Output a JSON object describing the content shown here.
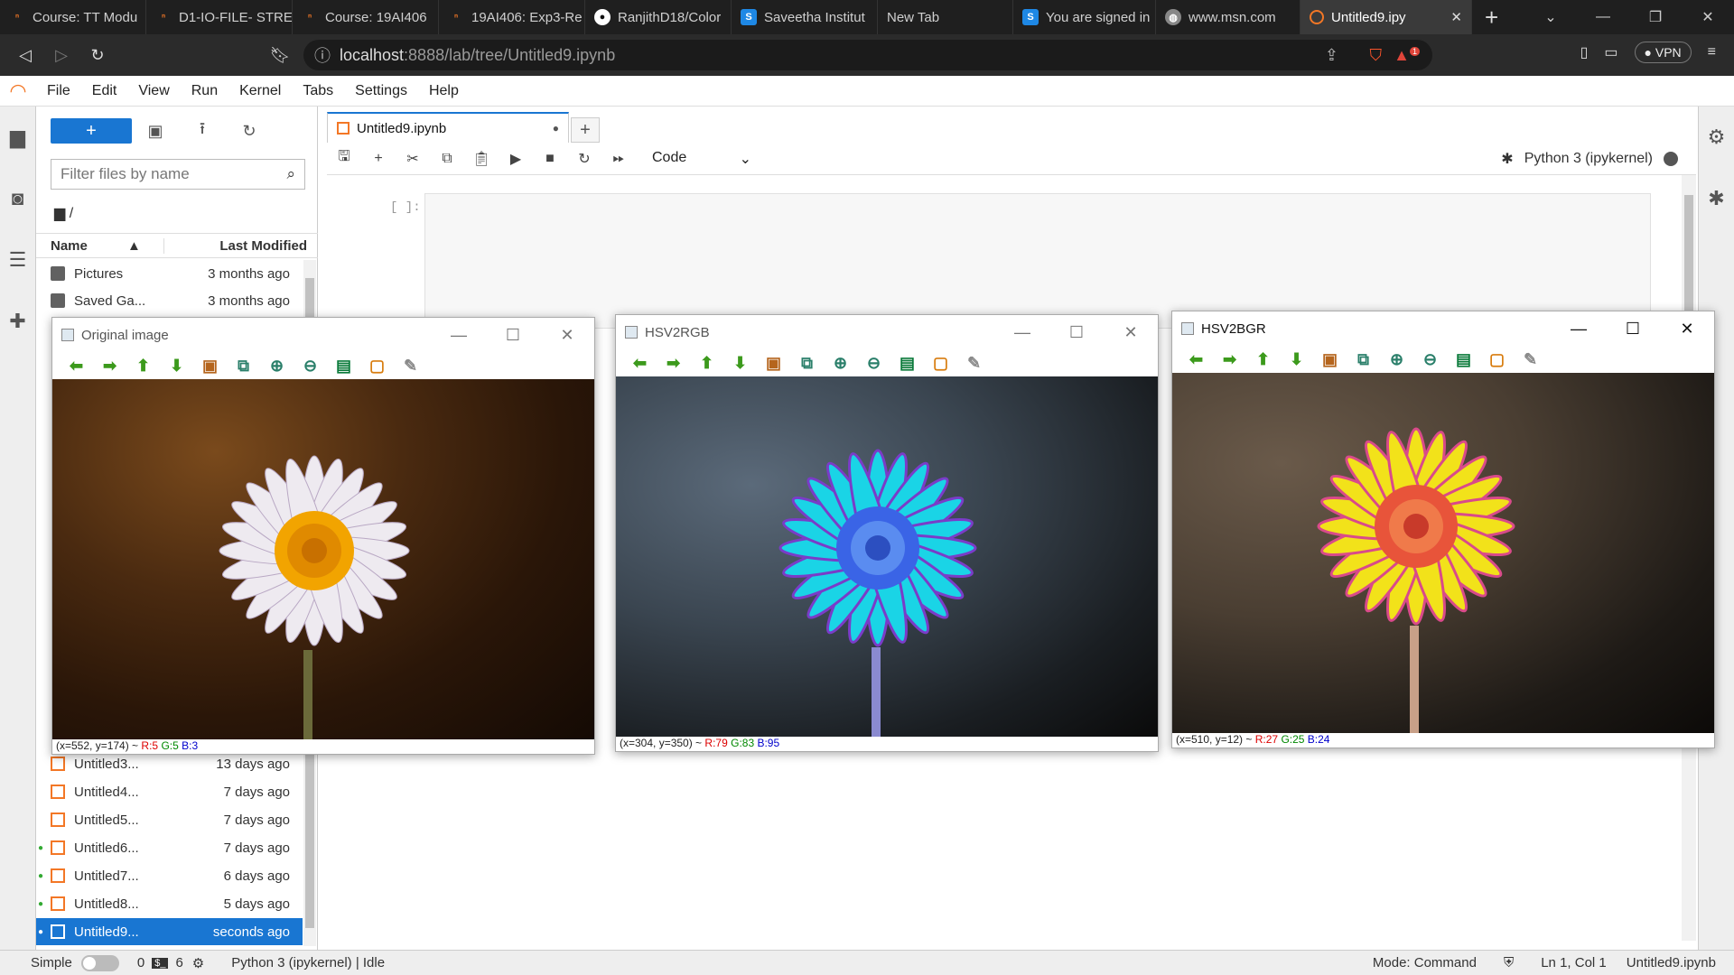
{
  "browser": {
    "tabs": [
      {
        "label": "Course: TT Modu",
        "icon": "moodle-icon",
        "color": "#f37726"
      },
      {
        "label": "D1-IO-FILE- STRE",
        "icon": "moodle-icon",
        "color": "#f37726"
      },
      {
        "label": "Course: 19AI406",
        "icon": "moodle-icon",
        "color": "#f37726"
      },
      {
        "label": "19AI406: Exp3-Re",
        "icon": "moodle-icon",
        "color": "#f37726"
      },
      {
        "label": "RanjithD18/Color",
        "icon": "github-icon",
        "color": "#ffffff"
      },
      {
        "label": "Saveetha Institut",
        "icon": "saveetha-icon",
        "color": "#1e88e5"
      },
      {
        "label": "New Tab",
        "icon": "",
        "color": "#1f1f1f"
      },
      {
        "label": "You are signed in",
        "icon": "saveetha-icon",
        "color": "#1e88e5"
      },
      {
        "label": "www.msn.com",
        "icon": "globe-icon",
        "color": "#888888"
      }
    ],
    "active_tab": {
      "label": "Untitled9.ipy",
      "icon": "jupyter-icon"
    },
    "url_host": "localhost",
    "url_rest": ":8888/lab/tree/Untitled9.ipynb",
    "vpn_label": "VPN",
    "brave_badge": "1"
  },
  "menu": [
    "File",
    "Edit",
    "View",
    "Run",
    "Kernel",
    "Tabs",
    "Settings",
    "Help"
  ],
  "filebrowser": {
    "new_label": "+",
    "filter_placeholder": "Filter files by name",
    "path": "/",
    "col_name": "Name",
    "col_modified": "Last Modified",
    "files_top": [
      {
        "name": "Pictures",
        "modified": "3 months ago",
        "type": "folder",
        "running": false
      },
      {
        "name": "Saved Ga...",
        "modified": "3 months ago",
        "type": "folder",
        "running": false
      }
    ],
    "files_bottom": [
      {
        "name": "Untitled3...",
        "modified": "13 days ago",
        "running": false
      },
      {
        "name": "Untitled4...",
        "modified": "7 days ago",
        "running": false
      },
      {
        "name": "Untitled5...",
        "modified": "7 days ago",
        "running": false
      },
      {
        "name": "Untitled6...",
        "modified": "7 days ago",
        "running": true
      },
      {
        "name": "Untitled7...",
        "modified": "6 days ago",
        "running": true
      },
      {
        "name": "Untitled8...",
        "modified": "5 days ago",
        "running": true
      },
      {
        "name": "Untitled9...",
        "modified": "seconds ago",
        "running": true,
        "selected": true
      }
    ]
  },
  "notebook": {
    "tab_label": "Untitled9.ipynb",
    "cell_type": "Code",
    "kernel": "Python 3 (ipykernel)",
    "prompt": "[ ]:"
  },
  "statusbar": {
    "mode_simple": "Simple",
    "terminals": "0",
    "kernels": "6",
    "kernel_status": "Python 3 (ipykernel) | Idle",
    "mode": "Mode: Command",
    "cursor": "Ln 1, Col 1",
    "filename": "Untitled9.ipynb"
  },
  "cv_windows": [
    {
      "title": "Original image",
      "coords": "(x=552, y=174) ~",
      "r": "R:5",
      "g": "G:5",
      "b": "B:3"
    },
    {
      "title": "HSV2RGB",
      "coords": "(x=304, y=350) ~",
      "r": "R:79",
      "g": "G:83",
      "b": "B:95"
    },
    {
      "title": "HSV2BGR",
      "coords": "(x=510, y=12) ~",
      "r": "R:27",
      "g": "G:25",
      "b": "B:24"
    }
  ]
}
